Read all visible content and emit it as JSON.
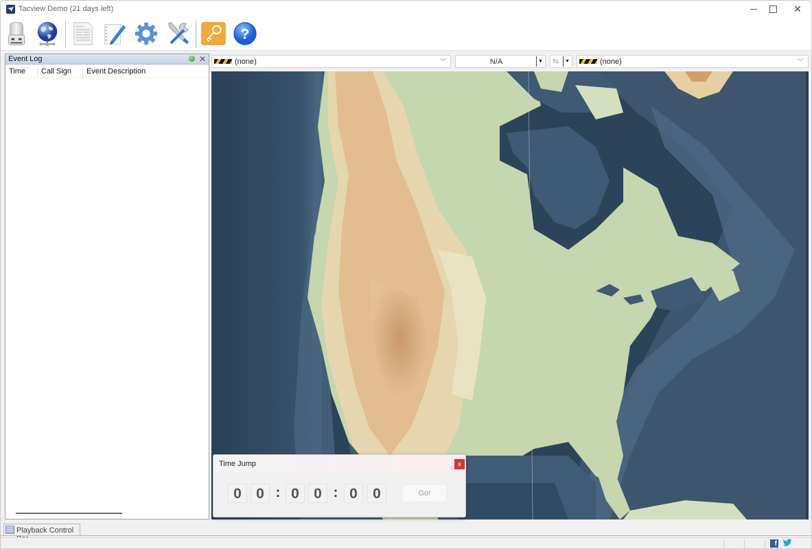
{
  "window": {
    "title": "Tacview Demo (21 days left)",
    "controls": {
      "minimize": "minimize",
      "maximize": "maximize",
      "close": "✕"
    }
  },
  "toolbar": {
    "buttons": [
      {
        "id": "open-file",
        "icon": "usb-drive-icon"
      },
      {
        "id": "online",
        "icon": "globe-network-icon"
      },
      {
        "id": "flight-log",
        "icon": "document-icon"
      },
      {
        "id": "notes",
        "icon": "notepad-pen-icon"
      },
      {
        "id": "settings",
        "icon": "gear-icon"
      },
      {
        "id": "tools",
        "icon": "tools-icon"
      },
      {
        "id": "license",
        "icon": "key-icon"
      },
      {
        "id": "help",
        "icon": "help-icon"
      }
    ]
  },
  "event_log": {
    "title": "Event Log",
    "columns": [
      "Time",
      "Call Sign",
      "Event Description"
    ],
    "rows": []
  },
  "selectors": {
    "primary_object": "(none)",
    "secondary_object": "(none)",
    "relation": "N/A"
  },
  "time_jump": {
    "title": "Time Jump",
    "close_label": "x",
    "digits": [
      "0",
      "0",
      "0",
      "0",
      "0",
      "0"
    ],
    "separator": ":",
    "go_label": "Go!"
  },
  "bottom": {
    "playback_tab": "Playback Control Bar"
  },
  "status": {
    "facebook": "f",
    "twitter": "🐦"
  },
  "colors": {
    "ocean_deep": "#2c4459",
    "ocean_shelf": "#4b6680",
    "land_low": "#c5d5ad",
    "land_mid": "#e7dcb3",
    "land_high": "#d9ad7f",
    "close_red": "#d2383b"
  }
}
